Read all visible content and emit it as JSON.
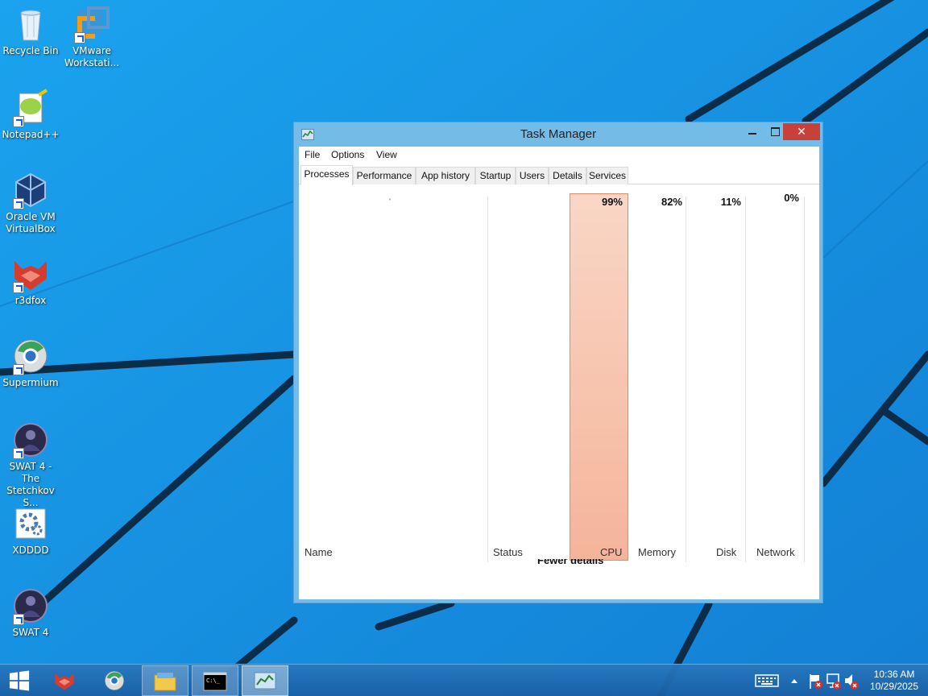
{
  "desktop": {
    "icons": [
      {
        "label": "Recycle Bin",
        "icon": "recycle-bin-icon"
      },
      {
        "label": "VMware Workstati...",
        "icon": "vmware-icon"
      },
      {
        "label": "Notepad++",
        "icon": "notepadpp-icon"
      },
      {
        "label": "Oracle VM VirtualBox",
        "icon": "virtualbox-icon"
      },
      {
        "label": "r3dfox",
        "icon": "r3dfox-icon"
      },
      {
        "label": "Supermium",
        "icon": "supermium-icon"
      },
      {
        "label": "SWAT 4 - The Stetchkov S...",
        "icon": "swat4-icon"
      },
      {
        "label": "XDDDD",
        "icon": "settings-gear-icon"
      },
      {
        "label": "SWAT 4",
        "icon": "swat4-icon"
      }
    ]
  },
  "task_manager": {
    "title": "Task Manager",
    "close_glyph": "✕",
    "menu": [
      "File",
      "Options",
      "View"
    ],
    "tabs": [
      "Processes",
      "Performance",
      "App history",
      "Startup",
      "Users",
      "Details",
      "Services"
    ],
    "active_tab": "Processes",
    "columns": {
      "name": "Name",
      "status": "Status",
      "cpu": "CPU",
      "memory": "Memory",
      "disk": "Disk",
      "network": "Network"
    },
    "usage": {
      "cpu": "99%",
      "memory": "82%",
      "disk": "11%",
      "network": "0%"
    },
    "footer_link": "Fewer details",
    "sort_caret": "˄"
  },
  "taskbar": {
    "buttons": [
      {
        "name": "start-button",
        "icon": "windows-logo-icon"
      },
      {
        "name": "r3dfox",
        "icon": "r3dfox-icon"
      },
      {
        "name": "supermium",
        "icon": "supermium-icon"
      },
      {
        "name": "file-explorer",
        "icon": "folder-icon"
      },
      {
        "name": "command-prompt",
        "icon": "cmd-icon"
      },
      {
        "name": "task-manager",
        "icon": "task-manager-icon"
      }
    ],
    "tray": {
      "icons": [
        "keyboard-icon",
        "show-hidden-icons-chevron",
        "action-center-flag-icon",
        "network-icon",
        "volume-muted-icon"
      ],
      "time": "10:36 AM",
      "date": "10/29/2025"
    }
  },
  "colors": {
    "desktop_bg": "#1a8fe0",
    "window_frame": "#74bce8",
    "close_button": "#c7413a",
    "cpu_highlight": "#f7c2ab"
  }
}
